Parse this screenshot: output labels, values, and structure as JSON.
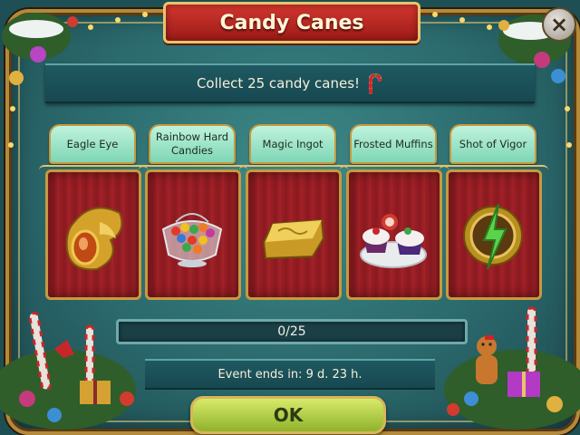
{
  "title": "Candy Canes",
  "close_glyph": "×",
  "subtitle": "Collect 25 candy canes!",
  "items": [
    {
      "label": "Eagle Eye",
      "icon": "eagle-eye-amulet-icon"
    },
    {
      "label": "Rainbow Hard Candies",
      "icon": "candy-bowl-icon"
    },
    {
      "label": "Magic Ingot",
      "icon": "gold-ingot-icon"
    },
    {
      "label": "Frosted Muffins",
      "icon": "muffins-plate-icon"
    },
    {
      "label": "Shot of Vigor",
      "icon": "vigor-medallion-icon"
    }
  ],
  "progress": {
    "text": "0/25",
    "current": 0,
    "total": 25
  },
  "event_ends": "Event ends in: 9 d. 23 h.",
  "ok_label": "OK",
  "colors": {
    "title_red": "#c02a25",
    "panel_red": "#9b1f25",
    "label_mint": "#9fe6c9",
    "ok_green": "#b7d14a",
    "frame_teal": "#2b6a6d"
  }
}
